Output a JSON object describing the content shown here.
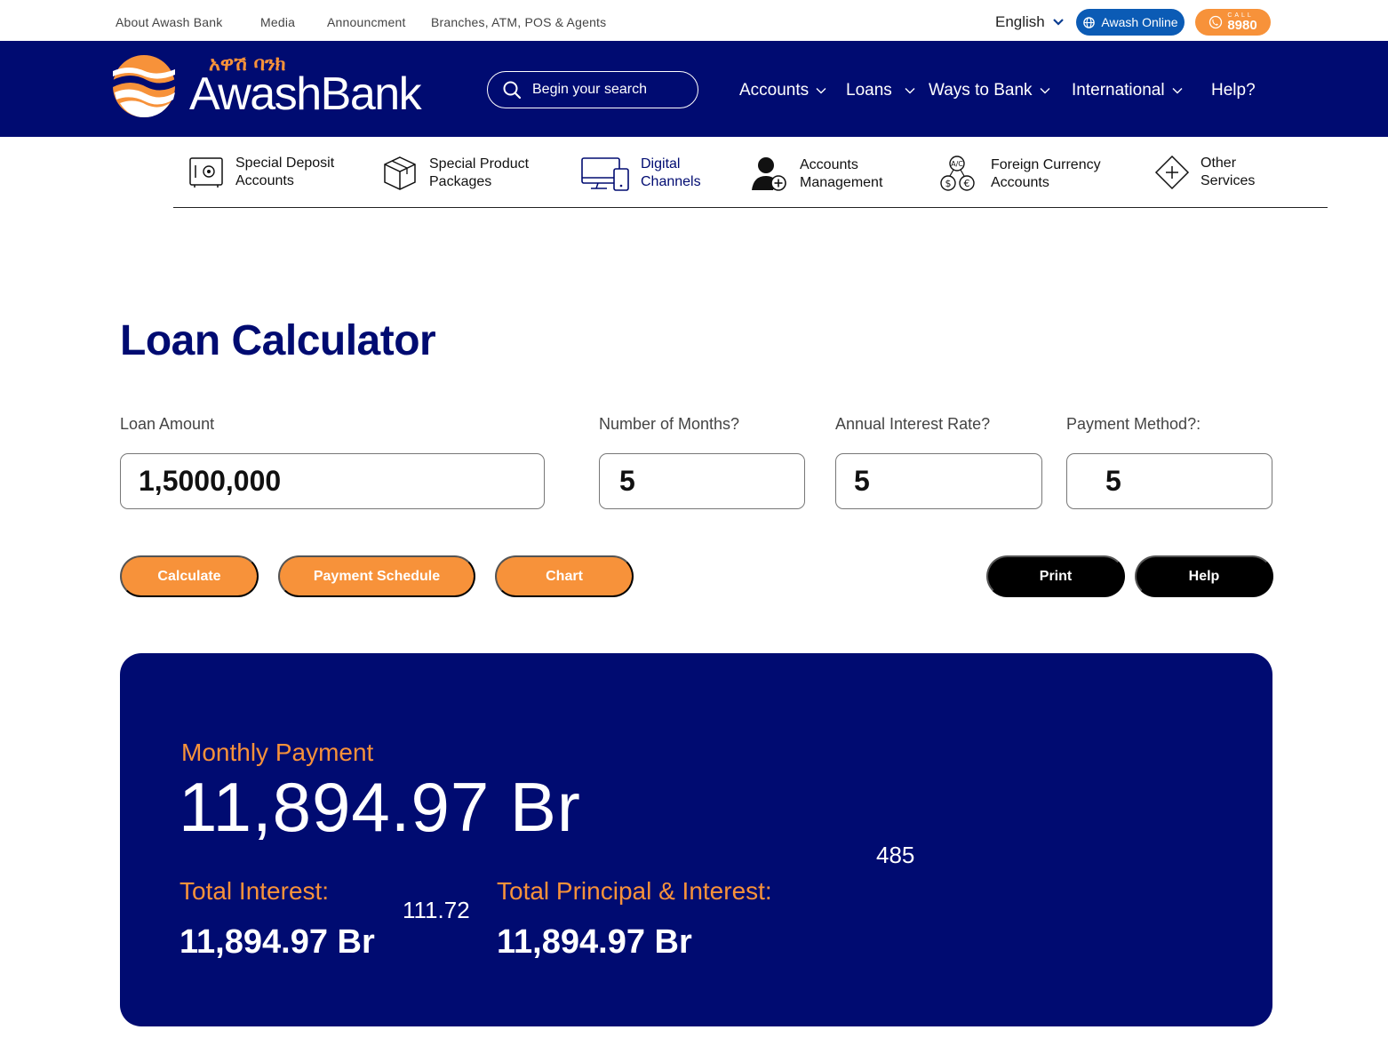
{
  "topbar": {
    "links": [
      "About Awash Bank",
      "Media",
      "Announcment",
      "Branches, ATM, POS & Agents"
    ],
    "language": "English",
    "online_label": "Awash Online",
    "call_word": "CALL",
    "call_number": "8980"
  },
  "header": {
    "logo_amharic": "አዋሽ ባንክ",
    "logo_text": "AwashBank",
    "search_placeholder": "Begin your search",
    "nav": [
      "Accounts",
      "Loans",
      "Ways to Bank",
      "International",
      "Help?"
    ]
  },
  "categories": [
    {
      "label": "Special Deposit\nAccounts",
      "icon": "safe-icon"
    },
    {
      "label": "Special Product\nPackages",
      "icon": "package-icon"
    },
    {
      "label": "Digital\nChannels",
      "icon": "devices-icon"
    },
    {
      "label": "Accounts\nManagement",
      "icon": "user-add-icon"
    },
    {
      "label": "Foreign Currency\nAccounts",
      "icon": "currency-icon"
    },
    {
      "label": "Other\nServices",
      "icon": "plus-diamond-icon"
    }
  ],
  "calculator": {
    "title": "Loan Calculator",
    "fields": [
      {
        "label": "Loan Amount",
        "value": "1,5000,000"
      },
      {
        "label": "Number of Months?",
        "value": "5"
      },
      {
        "label": "Annual Interest Rate?",
        "value": "5"
      },
      {
        "label": "Payment Method?:",
        "value": "5"
      }
    ],
    "buttons": {
      "calculate": "Calculate",
      "schedule": "Payment Schedule",
      "chart": "Chart",
      "print": "Print",
      "help": "Help"
    }
  },
  "results": {
    "monthly_label": "Monthly Payment",
    "monthly_value": "11,894.97 Br",
    "stray_value_1": "485",
    "interest_label": "Total Interest:",
    "interest_value": "11,894.97 Br",
    "stray_value_2": "111.72",
    "total_label": "Total Principal & Interest:",
    "total_value": "11,894.97 Br"
  },
  "colors": {
    "navy": "#000b71",
    "orange": "#f7923a",
    "online_blue": "#0b5bb5"
  }
}
